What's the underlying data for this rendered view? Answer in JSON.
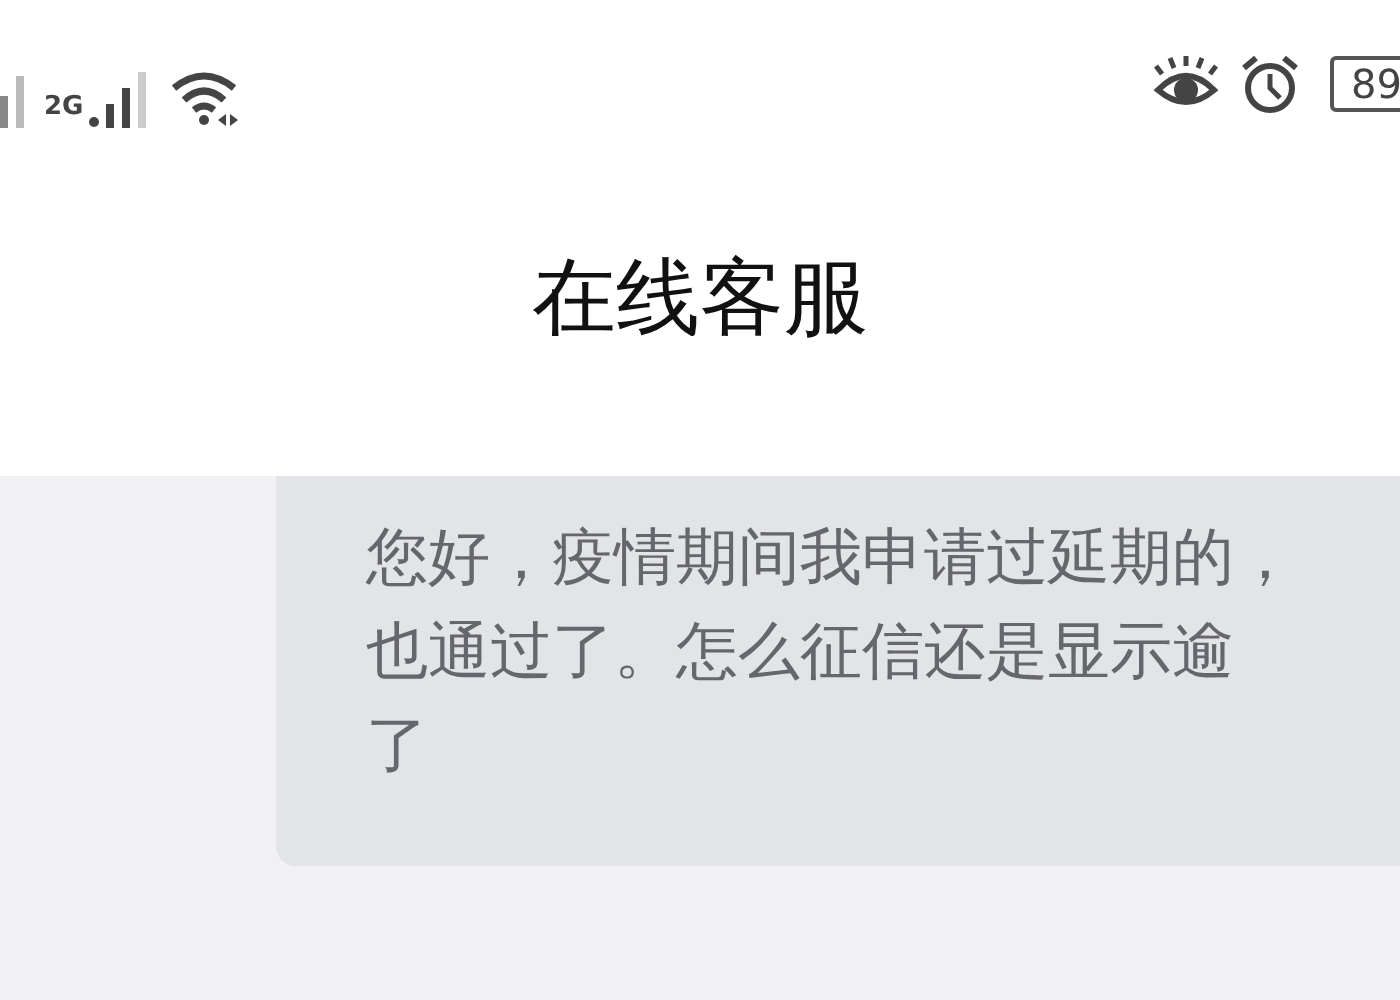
{
  "status_bar": {
    "network": "2G",
    "battery": "89"
  },
  "header": {
    "title": "在线客服"
  },
  "messages": [
    {
      "lines": [
        "您好，疫情期间我申请过延期的，",
        "也通过了。怎么征信还是显示逾",
        "了"
      ]
    }
  ]
}
